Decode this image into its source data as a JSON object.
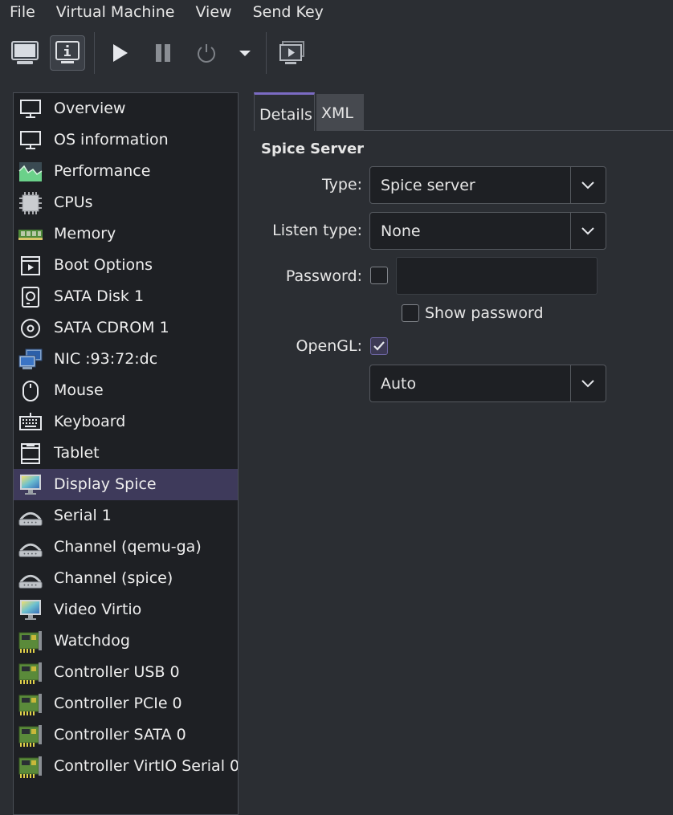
{
  "menu": [
    "File",
    "Virtual Machine",
    "View",
    "Send Key"
  ],
  "toolbar": {
    "console": "monitor-icon",
    "details": "info-icon",
    "run": "play-icon",
    "pause": "pause-icon",
    "shutdown": "power-icon",
    "shutdown_menu": "dropdown-arrow-icon",
    "snapshots": "snapshot-icon"
  },
  "sidebar": {
    "items": [
      {
        "label": "Overview",
        "icon": "monitor-icon"
      },
      {
        "label": "OS information",
        "icon": "monitor-icon"
      },
      {
        "label": "Performance",
        "icon": "performance-icon"
      },
      {
        "label": "CPUs",
        "icon": "cpu-icon"
      },
      {
        "label": "Memory",
        "icon": "memory-icon"
      },
      {
        "label": "Boot Options",
        "icon": "boot-icon"
      },
      {
        "label": "SATA Disk 1",
        "icon": "disk-icon"
      },
      {
        "label": "SATA CDROM 1",
        "icon": "cdrom-icon"
      },
      {
        "label": "NIC :93:72:dc",
        "icon": "network-icon"
      },
      {
        "label": "Mouse",
        "icon": "mouse-icon"
      },
      {
        "label": "Keyboard",
        "icon": "keyboard-icon"
      },
      {
        "label": "Tablet",
        "icon": "tablet-icon"
      },
      {
        "label": "Display Spice",
        "icon": "display-icon",
        "selected": true
      },
      {
        "label": "Serial 1",
        "icon": "serial-icon"
      },
      {
        "label": "Channel (qemu-ga)",
        "icon": "serial-icon"
      },
      {
        "label": "Channel (spice)",
        "icon": "serial-icon"
      },
      {
        "label": "Video Virtio",
        "icon": "display-icon"
      },
      {
        "label": "Watchdog",
        "icon": "card-icon"
      },
      {
        "label": "Controller USB 0",
        "icon": "card-icon"
      },
      {
        "label": "Controller PCIe 0",
        "icon": "card-icon"
      },
      {
        "label": "Controller SATA 0",
        "icon": "card-icon"
      },
      {
        "label": "Controller VirtIO Serial 0",
        "icon": "card-icon"
      }
    ]
  },
  "tabs": [
    {
      "label": "Details",
      "active": true
    },
    {
      "label": "XML",
      "active": false
    }
  ],
  "details": {
    "section_title": "Spice Server",
    "type_label": "Type:",
    "type_value": "Spice server",
    "listen_label": "Listen type:",
    "listen_value": "None",
    "password_label": "Password:",
    "password_enabled": false,
    "password_value": "",
    "show_password_label": "Show password",
    "show_password_checked": false,
    "opengl_label": "OpenGL:",
    "opengl_checked": true,
    "rendernode_value": "Auto"
  },
  "colors": {
    "background": "#2b2e33",
    "sidebar_bg": "#1e2024",
    "selected_bg": "#3e3a5b",
    "accent": "#7b6bc4"
  }
}
